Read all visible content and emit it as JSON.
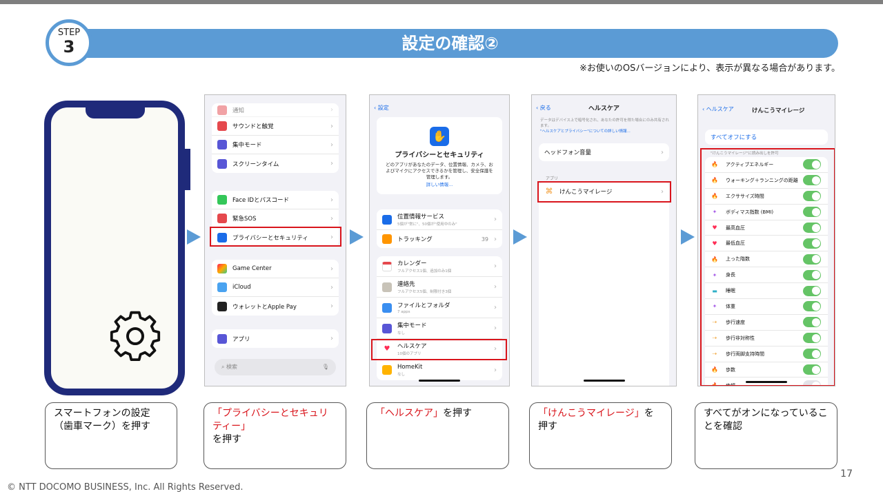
{
  "header": {
    "step_label": "STEP",
    "step_number": "3",
    "title": "設定の確認②",
    "note": "※お使いのOSバージョンにより、表示が異なる場合があります。"
  },
  "screen1": {
    "title": "設定",
    "rows_top": [
      "通知",
      "サウンドと触覚",
      "集中モード",
      "スクリーンタイム"
    ],
    "rows_mid": [
      "Face IDとパスコード",
      "緊急SOS",
      "プライバシーとセキュリティ"
    ],
    "rows_low": [
      "Game Center",
      "iCloud",
      "ウォレットとApple Pay"
    ],
    "rows_app": [
      "アプリ"
    ],
    "search_placeholder": "検索"
  },
  "screen2": {
    "back": "設定",
    "title": "プライバシーとセキュリティ",
    "description": "どのアプリがあなたのデータ、位置情報、カメラ、およびマイクにアクセスできるかを管理し、安全保護を管理します。",
    "link": "詳しい情報...",
    "rows_a": [
      {
        "label": "位置情報サービス",
        "sub": "5個が\"常に\"、50個が\"使用中のみ\"",
        "val": ""
      },
      {
        "label": "トラッキング",
        "sub": "",
        "val": "39"
      }
    ],
    "rows_b": [
      {
        "label": "カレンダー",
        "sub": "フルアクセス1個、追加のみ1個"
      },
      {
        "label": "連絡先",
        "sub": "フルアクセス5個、制限付き3個"
      },
      {
        "label": "ファイルとフォルダ",
        "sub": "7 apps"
      },
      {
        "label": "集中モード",
        "sub": "なし"
      },
      {
        "label": "ヘルスケア",
        "sub": "10個のアプリ"
      },
      {
        "label": "HomeKit",
        "sub": "なし"
      }
    ]
  },
  "screen3": {
    "back": "戻る",
    "title": "ヘルスケア",
    "description": "データはデバイス上で暗号化され、あなたの許可を得た場合にのみ共有されます。",
    "link": "\"ヘルスケアとプライバシー\"についての詳しい情報...",
    "headphone": "ヘッドフォン音量",
    "section": "アプリ",
    "app": "けんこうマイレージ"
  },
  "screen4": {
    "back": "ヘルスケア",
    "title": "けんこうマイレージ",
    "all_off": "すべてオフにする",
    "section": "\"けんこうマイレージ\"に読み出しを許可",
    "items": [
      "アクティブエネルギー",
      "ウォーキング＋ランニングの距離",
      "エクササイズ時間",
      "ボディマス指数 (BMI)",
      "最高血圧",
      "最低血圧",
      "上った階数",
      "身長",
      "睡眠",
      "体重",
      "歩行速度",
      "歩行非対称性",
      "歩行両脚支持時間",
      "歩数",
      "歩幅"
    ]
  },
  "captions": {
    "c1": "スマートフォンの設定\n（歯車マーク）を押す",
    "c2_red": "「プライバシーとセキュリティー」",
    "c2_rest": "を押す",
    "c3_red": "「ヘルスケア」",
    "c3_rest": "を押す",
    "c4_red": "「けんこうマイレージ」",
    "c4_rest": "を押す",
    "c5": "すべてがオンになっていることを確認"
  },
  "footer": {
    "page": "17",
    "copyright": "© NTT DOCOMO BUSINESS, Inc. All Rights Reserved."
  },
  "colors": {
    "accent": "#5b9bd5",
    "highlight": "#d9141b",
    "phone": "#1f2a7a",
    "toggle_on": "#65c466"
  },
  "icons": [
    "gear-icon",
    "arrow-right-icon",
    "chevron-right-icon",
    "hand-icon",
    "heart-icon",
    "flame-icon",
    "figure-icon",
    "bed-icon",
    "search-icon",
    "mic-icon"
  ]
}
